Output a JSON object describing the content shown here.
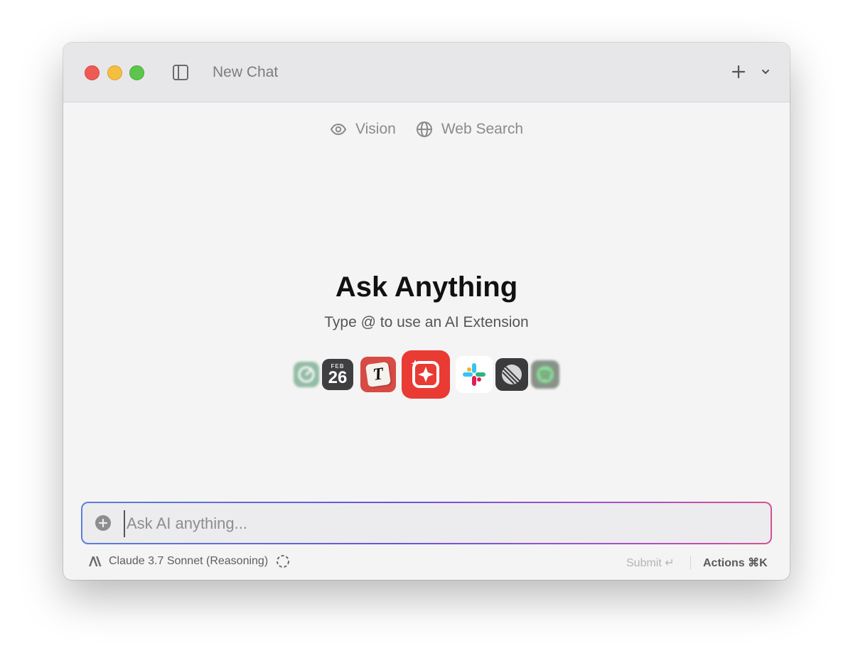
{
  "window": {
    "title": "New Chat"
  },
  "titlebar": {
    "close_icon": "red-close-light",
    "minimize_icon": "yellow-minimize-light",
    "zoom_icon": "green-zoom-light",
    "sidebar_icon": "sidebar-toggle-icon",
    "new_icon": "plus-icon",
    "menu_icon": "chevron-down-icon"
  },
  "toggles": [
    {
      "icon": "eye-icon",
      "label": "Vision"
    },
    {
      "icon": "globe-icon",
      "label": "Web Search"
    }
  ],
  "main": {
    "heading": "Ask Anything",
    "subheading": "Type @ to use an AI Extension"
  },
  "extensions": {
    "calendar_month": "FEB",
    "calendar_day": "26",
    "typora_letter": "T",
    "icons": [
      "clock-app-icon",
      "calendar-app-icon",
      "typora-app-icon",
      "raycast-ai-icon",
      "slack-icon",
      "linear-icon",
      "spotify-icon"
    ]
  },
  "composer": {
    "placeholder": "Ask AI anything...",
    "value": ""
  },
  "footer": {
    "model": "Claude 3.7 Sonnet (Reasoning)",
    "submit": "Submit ↵",
    "actions": "Actions ⌘K"
  },
  "colors": {
    "accent_gradient": [
      "#5b7fd9",
      "#6a56d6",
      "#a150cc",
      "#d15296"
    ],
    "close": "#ee5b55",
    "minimize": "#f4be3f",
    "zoom": "#5ec54c",
    "raycast_red": "#e93a33"
  }
}
